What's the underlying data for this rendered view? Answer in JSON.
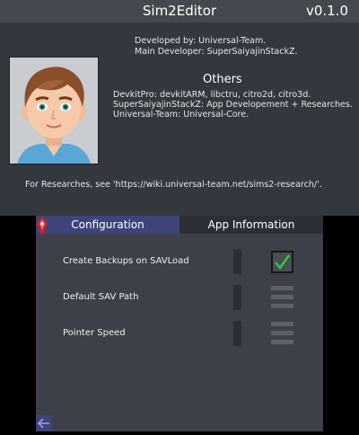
{
  "top": {
    "title": "Sim2Editor",
    "version": "v0.1.0",
    "developed_by": "Developed by: Universal-Team.",
    "main_developer": "Main Developer: SuperSaiyajinStackZ.",
    "others_title": "Others",
    "others": [
      "DevkitPro: devkitARM, libctru, citro2d, citro3d.",
      "SuperSaiyajinStackZ: App Developement + Researches.",
      "Universal-Team: Universal-Core."
    ],
    "research_note": "For Researches, see 'https://wiki.universal-team.net/sims2-research/'."
  },
  "bottom": {
    "tabs": [
      "Configuration",
      "App Information"
    ],
    "settings": [
      {
        "label": "Create Backups on SAVLoad",
        "control": "checkbox",
        "checked": true
      },
      {
        "label": "Default SAV Path",
        "control": "menu"
      },
      {
        "label": "Pointer Speed",
        "control": "menu"
      }
    ]
  },
  "colors": {
    "accent": "#3e4479",
    "check": "#2ecc40"
  }
}
